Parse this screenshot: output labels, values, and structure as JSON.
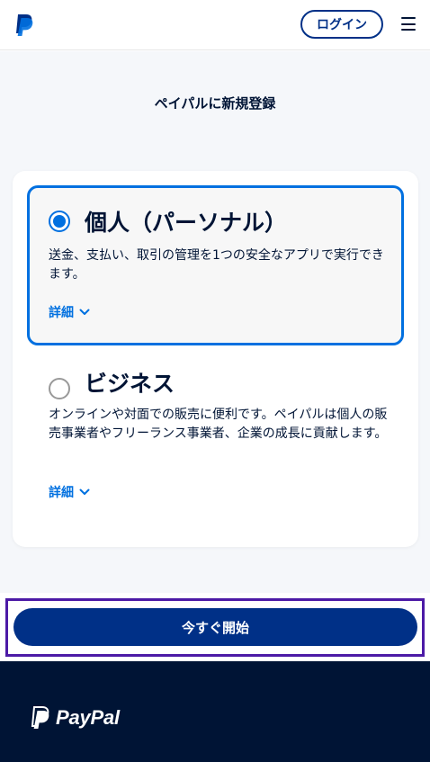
{
  "header": {
    "logo_icon": "paypal-p-icon",
    "login_label": "ログイン",
    "menu_icon": "hamburger-menu-icon"
  },
  "main": {
    "title": "ペイパルに新規登録",
    "options": [
      {
        "title": "個人（パーソナル）",
        "description": "送金、支払い、取引の管理を1つの安全なアプリで実行できます。",
        "details_label": "詳細",
        "selected": true
      },
      {
        "title": "ビジネス",
        "description": "オンラインや対面での販売に便利です。ペイパルは個人の販売事業者やフリーランス事業者、企業の成長に貢献します。",
        "details_label": "詳細",
        "selected": false
      }
    ]
  },
  "cta": {
    "start_label": "今すぐ開始"
  },
  "footer": {
    "brand": "PayPal"
  },
  "colors": {
    "primary_navy": "#003087",
    "accent_blue": "#0070e0",
    "footer_bg": "#001435",
    "focus_outline": "#4c1aa6"
  }
}
